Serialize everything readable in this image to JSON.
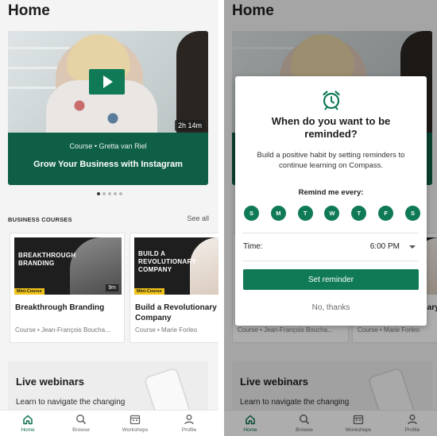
{
  "home": {
    "title": "Home",
    "hero": {
      "duration": "2h 14m",
      "meta": "Course •  Gretta  van Riel",
      "title": "Grow Your Business with Instagram",
      "carousel_page": 1,
      "carousel_total": 5
    },
    "courses": {
      "section_label": "BUSINESS COURSES",
      "see_all": "See all",
      "items": [
        {
          "thumb_text": "BREAKTHROUGH\nBRANDING",
          "badge": "Mini-Course",
          "duration": "9m",
          "title": "Breakthrough Branding",
          "subtitle": "Course • Jean-François Boucha..."
        },
        {
          "thumb_text": "BUILD A\nREVOLUTIONARY\nCOMPANY",
          "badge": "Mini-Course",
          "duration": "",
          "title": "Build a Revolutionary Company",
          "subtitle": "Course • Marie  Forleo"
        }
      ]
    },
    "webinars": {
      "title": "Live webinars",
      "subtitle": "Learn to navigate the changing"
    }
  },
  "tabbar": {
    "items": [
      {
        "label": "Home",
        "icon": "home-icon",
        "active": true
      },
      {
        "label": "Browse",
        "icon": "search-icon",
        "active": false
      },
      {
        "label": "Workshops",
        "icon": "calendar-icon",
        "active": false
      },
      {
        "label": "Profile",
        "icon": "profile-icon",
        "active": false
      }
    ]
  },
  "reminder_modal": {
    "title": "When do you want to be reminded?",
    "text": "Build a positive habit by setting reminders to continue learning on Compass.",
    "remind_label": "Remind me every:",
    "days": [
      "S",
      "M",
      "T",
      "W",
      "T",
      "F",
      "S"
    ],
    "time_label": "Time:",
    "time_value": "6:00 PM",
    "set_button": "Set reminder",
    "no_thanks": "No, thanks"
  },
  "colors": {
    "accent": "#0f7a55",
    "hero_band": "#0f5f46",
    "badge": "#f2c41a"
  }
}
